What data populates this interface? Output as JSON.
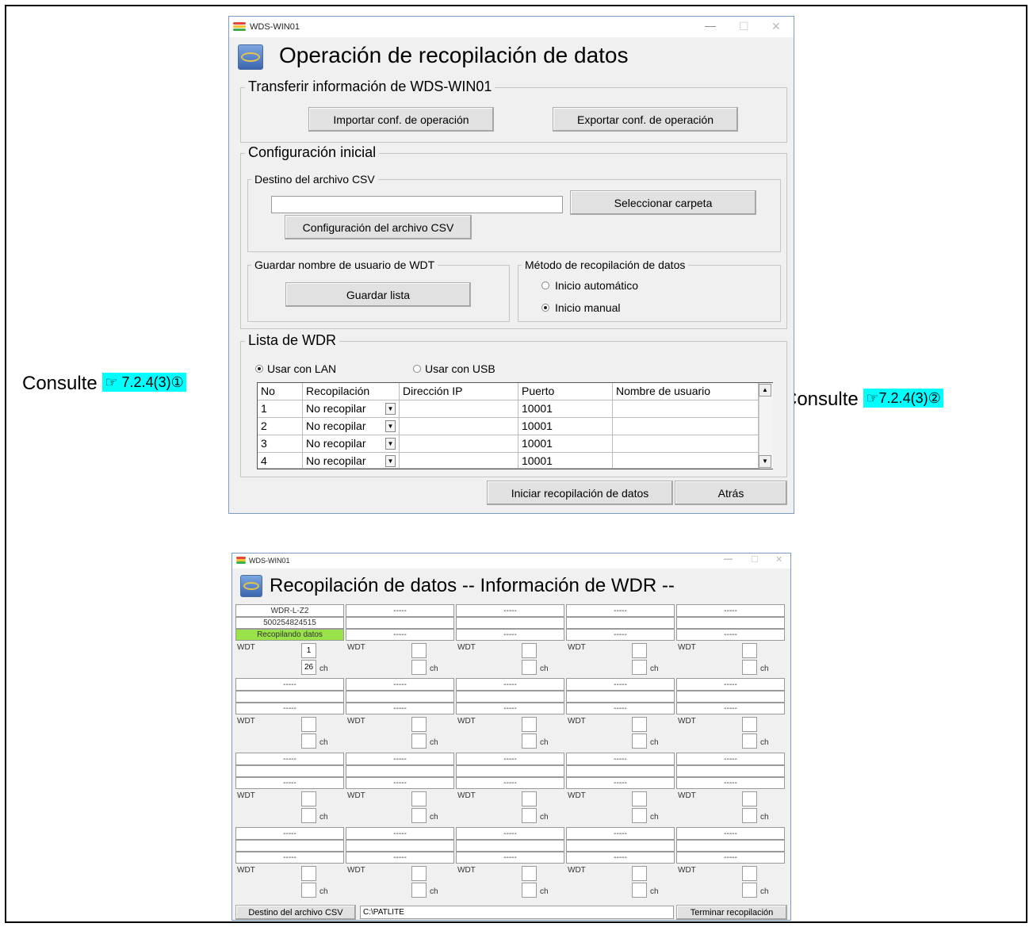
{
  "annotations": {
    "left": {
      "prefix": "Consulte",
      "ref": "☞ 7.2.4(3)①"
    },
    "right": {
      "prefix": "Consulte",
      "ref": "☞7.2.4(3)②"
    }
  },
  "window1": {
    "title": "WDS-WIN01",
    "heading": "Operación de recopilación de datos",
    "transfer": {
      "group": "Transferir información de WDS-WIN01",
      "import_btn": "Importar conf. de operación",
      "export_btn": "Exportar conf. de operación"
    },
    "initial": {
      "group": "Configuración inicial",
      "csv_group": "Destino del archivo CSV",
      "csv_path": "",
      "select_folder_btn": "Seleccionar carpeta",
      "csv_config_btn": "Configuración del archivo CSV",
      "save_user_group": "Guardar nombre de usuario de WDT",
      "save_list_btn": "Guardar lista",
      "method_group": "Método de recopilación de datos",
      "auto_start": "Inicio automático",
      "manual_start": "Inicio manual",
      "selected_method": "manual"
    },
    "wdr_list": {
      "group": "Lista de WDR",
      "lan": "Usar con LAN",
      "usb": "Usar con USB",
      "selected": "lan",
      "columns": [
        "No",
        "Recopilación",
        "Dirección IP",
        "Puerto",
        "Nombre de usuario"
      ],
      "rows": [
        {
          "no": "1",
          "mode": "No recopilar",
          "ip": "",
          "port": "10001",
          "user": ""
        },
        {
          "no": "2",
          "mode": "No recopilar",
          "ip": "",
          "port": "10001",
          "user": ""
        },
        {
          "no": "3",
          "mode": "No recopilar",
          "ip": "",
          "port": "10001",
          "user": ""
        },
        {
          "no": "4",
          "mode": "No recopilar",
          "ip": "",
          "port": "10001",
          "user": ""
        }
      ]
    },
    "start_btn": "Iniciar recopilación de datos",
    "back_btn": "Atrás"
  },
  "window2": {
    "title": "WDS-WIN01",
    "heading": "Recopilación de datos -- Información de WDR --",
    "panels": [
      {
        "model": "WDR-L-Z2",
        "serial": "500254824515",
        "status": "Recopilando datos",
        "status_color": "#99e24a",
        "wdt_label": "WDT",
        "wdt": "1",
        "ch": "26",
        "ch_label": "ch"
      }
    ],
    "empty_panel": {
      "model": "-----",
      "serial": "",
      "status": "-----",
      "wdt_label": "WDT",
      "ch_label": "ch"
    },
    "csv_btn": "Destino del archivo CSV",
    "csv_path": "C:\\PATLITE",
    "end_btn": "Terminar recopilación"
  }
}
